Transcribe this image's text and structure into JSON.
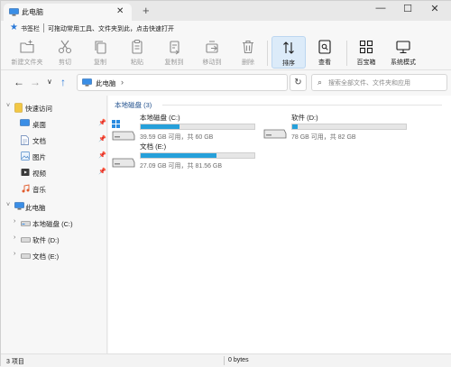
{
  "window": {
    "tab_title": "此电脑",
    "tab_close": "✕",
    "new_tab": "+",
    "minimize": "—",
    "maximize": "☐",
    "close": "✕"
  },
  "favorites_bar": {
    "label": "书签栏",
    "hint": "可拖动常用工具、文件夹到此，点击快速打开"
  },
  "ribbon": [
    {
      "label": "新建文件夹",
      "icon": "new-folder-icon",
      "enabled": false
    },
    {
      "label": "剪切",
      "icon": "scissors-icon",
      "enabled": false
    },
    {
      "label": "复制",
      "icon": "copy-icon",
      "enabled": false
    },
    {
      "label": "粘贴",
      "icon": "paste-icon",
      "enabled": false
    },
    {
      "label": "复制到",
      "icon": "copy-to-icon",
      "enabled": false
    },
    {
      "label": "移动到",
      "icon": "move-to-icon",
      "enabled": false
    },
    {
      "label": "删除",
      "icon": "trash-icon",
      "enabled": false
    },
    {
      "label": "排序",
      "icon": "sort-icon",
      "enabled": true,
      "selected": true
    },
    {
      "label": "查看",
      "icon": "view-icon",
      "enabled": true
    },
    {
      "label": "百宝箱",
      "icon": "toolbox-icon",
      "enabled": true
    },
    {
      "label": "系统模式",
      "icon": "monitor-icon",
      "enabled": true
    }
  ],
  "navigation": {
    "back": "←",
    "forward": "→",
    "recent": "∨",
    "up": "↑",
    "address_path": "此电脑",
    "address_separator": "›",
    "address_chevron": "›",
    "refresh": "↻",
    "search_placeholder": "搜索全部文件、文件夹和应用",
    "search_value": ""
  },
  "sidebar": {
    "quick_access": {
      "label": "快速访问"
    },
    "quick_items": [
      {
        "label": "桌面",
        "icon": "desktop-icon"
      },
      {
        "label": "文档",
        "icon": "documents-icon"
      },
      {
        "label": "图片",
        "icon": "pictures-icon"
      },
      {
        "label": "视频",
        "icon": "videos-icon"
      },
      {
        "label": "音乐",
        "icon": "music-icon"
      }
    ],
    "this_pc": {
      "label": "此电脑"
    },
    "drives": [
      {
        "label": "本地磁盘 (C:)"
      },
      {
        "label": "软件 (D:)"
      },
      {
        "label": "文档 (E:)"
      }
    ]
  },
  "content": {
    "group_header": "本地磁盘  (3)",
    "drives": [
      {
        "name": "本地磁盘 (C:)",
        "info": "39.59 GB 可用，共 60 GB",
        "used_fraction": 0.34,
        "system": true
      },
      {
        "name": "软件 (D:)",
        "info": "78 GB 可用，共 82 GB",
        "used_fraction": 0.05,
        "system": false
      },
      {
        "name": "文档 (E:)",
        "info": "27.09 GB 可用，共 81.56 GB",
        "used_fraction": 0.67,
        "system": false
      }
    ]
  },
  "status": {
    "items_count": "3 项目",
    "size": "0 bytes"
  },
  "colors": {
    "accent": "#2a79d8",
    "drive_bar": "#26a0da",
    "selected_button_bg": "#dcebf9",
    "folder_yellow": "#f2c744"
  }
}
